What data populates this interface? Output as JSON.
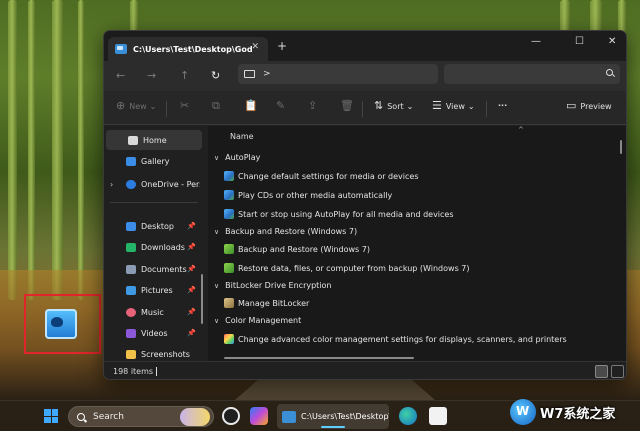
{
  "window": {
    "tab_title": "C:\\Users\\Test\\Desktop\\GodMo",
    "close_tab": "✕",
    "new_tab": "+",
    "controls": {
      "minimize": "—",
      "maximize": "☐",
      "close": "✕"
    }
  },
  "navbar": {
    "back": "←",
    "forward": "→",
    "up": "↑",
    "refresh": "↻",
    "address_chevron": ">"
  },
  "toolbar": {
    "new_label": "New",
    "sort_label": "Sort",
    "view_label": "View",
    "more_label": "···",
    "preview_label": "Preview",
    "new_icon": "⊕",
    "cut_icon": "✂",
    "copy_icon": "⧉",
    "paste_icon": "📋",
    "rename_icon": "✎",
    "share_icon": "⇪",
    "delete_icon": "🗑",
    "sort_icon": "⇅",
    "view_icon": "☰",
    "preview_icon": "▭",
    "dropdown": "⌄"
  },
  "sidebar": {
    "items": [
      {
        "label": "Home",
        "icon": "home-icon",
        "color": "#d9d9d9"
      },
      {
        "label": "Gallery",
        "icon": "gallery-icon",
        "color": "#3b8de8"
      },
      {
        "label": "OneDrive - Perso",
        "icon": "onedrive-icon",
        "color": "#2b7de0"
      },
      {
        "label": "Desktop",
        "icon": "desktop-icon",
        "color": "#3b8de8",
        "pin": "📌"
      },
      {
        "label": "Downloads",
        "icon": "downloads-icon",
        "color": "#25b569",
        "pin": "📌"
      },
      {
        "label": "Documents",
        "icon": "documents-icon",
        "color": "#8b9bb4",
        "pin": "📌"
      },
      {
        "label": "Pictures",
        "icon": "pictures-icon",
        "color": "#3f9ae6",
        "pin": "📌"
      },
      {
        "label": "Music",
        "icon": "music-icon",
        "color": "#e8637a",
        "pin": "📌"
      },
      {
        "label": "Videos",
        "icon": "videos-icon",
        "color": "#8a58d8",
        "pin": "📌"
      },
      {
        "label": "Screenshots",
        "icon": "folder-icon",
        "color": "#f0c24a"
      }
    ]
  },
  "content": {
    "column_name": "Name",
    "sort_caret": "^",
    "groups": [
      {
        "label": "AutoPlay",
        "chevron": "∨"
      },
      {
        "label": "Backup and Restore (Windows 7)",
        "chevron": "∨"
      },
      {
        "label": "BitLocker Drive Encryption",
        "chevron": "∨"
      },
      {
        "label": "Color Management",
        "chevron": "∨"
      }
    ],
    "items": [
      "Change default settings for media or devices",
      "Play CDs or other media automatically",
      "Start or stop using AutoPlay for all media and devices",
      "Backup and Restore (Windows 7)",
      "Restore data, files, or computer from backup (Windows 7)",
      "Manage BitLocker",
      "Change advanced color management settings for displays, scanners, and printers"
    ]
  },
  "status": {
    "item_count": "198 items"
  },
  "taskbar": {
    "search_label": "Search",
    "active_window": "C:\\Users\\Test\\Desktop\\G"
  },
  "watermark": {
    "text": "W7系统之家"
  }
}
